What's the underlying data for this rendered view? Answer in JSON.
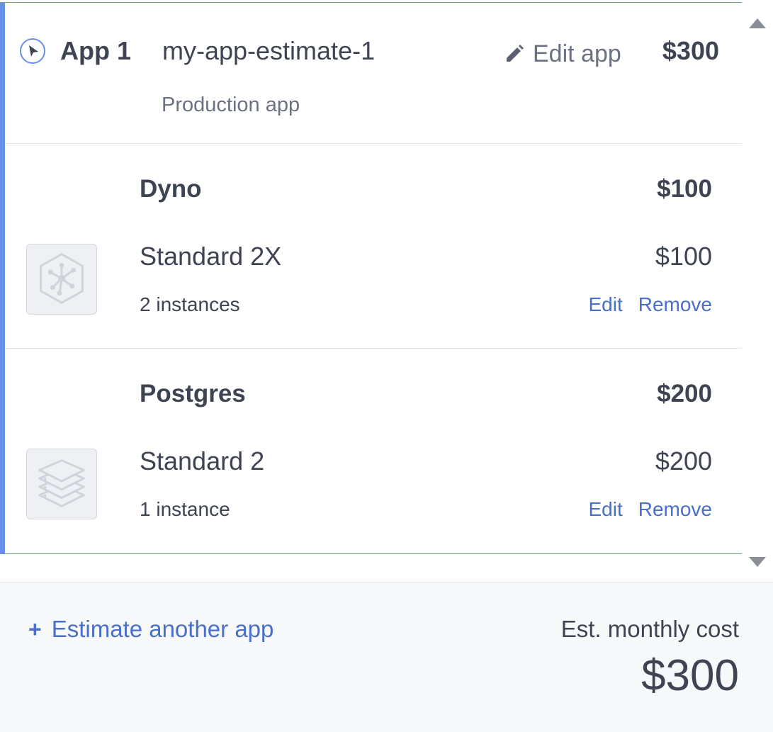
{
  "app": {
    "number_label": "App 1",
    "name": "my-app-estimate-1",
    "type": "Production app",
    "edit_label": "Edit app",
    "total": "$300"
  },
  "sections": [
    {
      "title": "Dyno",
      "total": "$100",
      "icon": "dyno-icon",
      "plan": "Standard 2X",
      "price": "$100",
      "quantity": "2 instances",
      "edit_label": "Edit",
      "remove_label": "Remove"
    },
    {
      "title": "Postgres",
      "total": "$200",
      "icon": "postgres-icon",
      "plan": "Standard 2",
      "price": "$200",
      "quantity": "1 instance",
      "edit_label": "Edit",
      "remove_label": "Remove"
    }
  ],
  "footer": {
    "add_label": "Estimate another app",
    "cost_label": "Est. monthly cost",
    "cost_total": "$300"
  },
  "colors": {
    "accent": "#6a8fe8",
    "link": "#4a6fc7",
    "text": "#3f4452",
    "muted": "#6b7180"
  }
}
